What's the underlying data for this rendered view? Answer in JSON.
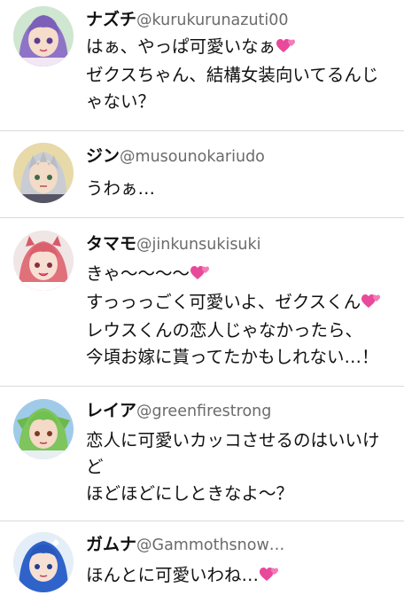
{
  "posts": [
    {
      "name": "ナズチ",
      "handle": "@kurukurunazuti00",
      "avatar_icon": "girl-purple-hair-avatar",
      "lines": [
        "はぁ、やっぱ可愛いなぁ",
        "ゼクスちゃん、結構女装向いてるんじ",
        "ゃない？"
      ],
      "heart_after_line": [
        true,
        false,
        false
      ]
    },
    {
      "name": "ジン",
      "handle": "@musounokariudo",
      "avatar_icon": "boy-silver-hair-avatar",
      "lines": [
        "うわぁ…"
      ],
      "heart_after_line": [
        false
      ]
    },
    {
      "name": "タマモ",
      "handle": "@jinkunsukisuki",
      "avatar_icon": "girl-pink-hair-avatar",
      "lines": [
        "きゃ〜〜〜〜",
        "すっっっごく可愛いよ、ゼクスくん",
        "レウスくんの恋人じゃなかったら、",
        "今頃お嫁に貰ってたかもしれない…！"
      ],
      "heart_after_line": [
        true,
        true,
        false,
        false
      ]
    },
    {
      "name": "レイア",
      "handle": "@greenfirestrong",
      "avatar_icon": "girl-green-hair-avatar",
      "lines": [
        "恋人に可愛いカッコさせるのはいいけ",
        "ど",
        "ほどほどにしときなよ〜？"
      ],
      "heart_after_line": [
        false,
        false,
        false
      ]
    },
    {
      "name": "ガムナ",
      "handle": "@Gammothsnow…",
      "avatar_icon": "girl-blue-hair-avatar",
      "lines": [
        "ほんとに可愛いわね…"
      ],
      "heart_after_line": [
        true
      ]
    }
  ],
  "colors": {
    "heart": "#e8499a",
    "divider": "#d9d9d9",
    "handle": "#6b6b6b"
  }
}
